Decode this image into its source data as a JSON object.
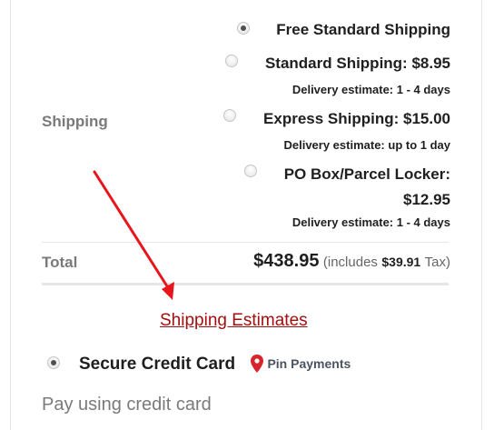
{
  "shipping": {
    "label": "Shipping",
    "options": [
      {
        "label": "Free Standard Shipping",
        "estimate": "",
        "checked": true
      },
      {
        "label": "Standard Shipping: $8.95",
        "estimate": "Delivery estimate: 1 - 4 days",
        "checked": false
      },
      {
        "label": "Express Shipping: $15.00",
        "estimate": "Delivery estimate: up to 1 day",
        "checked": false
      },
      {
        "label": "PO Box/Parcel Locker:",
        "price": "$12.95",
        "estimate": "Delivery estimate: 1 - 4 days",
        "checked": false
      }
    ]
  },
  "total": {
    "label": "Total",
    "amount": "$438.95",
    "tax_prefix": "(includes",
    "tax_amount": "$39.91",
    "tax_suffix": "Tax)"
  },
  "shipping_estimates_link": "Shipping Estimates",
  "payment": {
    "option_label": "Secure Credit Card",
    "checked": true,
    "provider": "Pin Payments",
    "description": "Pay using credit card"
  },
  "colors": {
    "link": "#a30f0f",
    "arrow": "#e8151b",
    "pin_logo": "#d6262b",
    "muted_label": "#7a7a7a"
  },
  "annotation": {
    "arrow": "arrow-pointing-to-shipping-estimates"
  }
}
